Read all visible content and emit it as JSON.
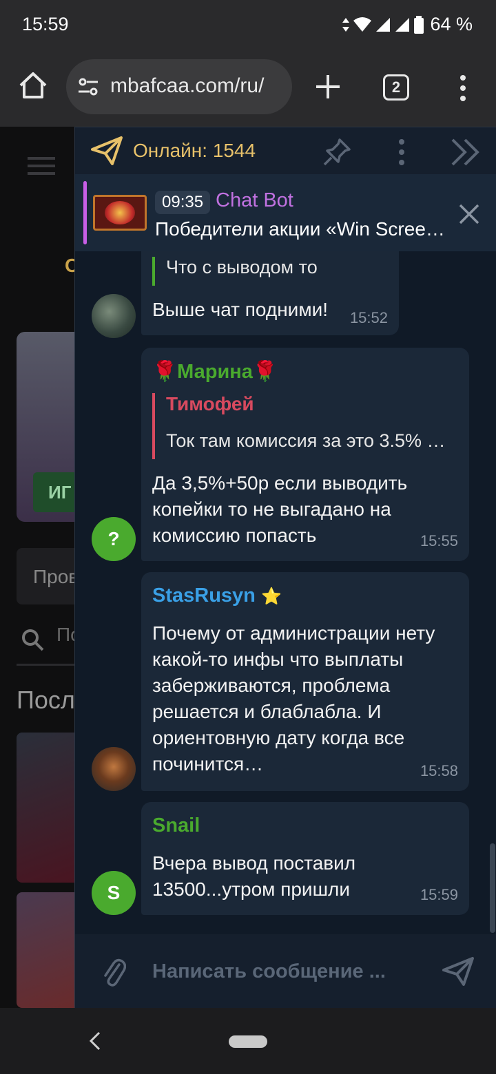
{
  "status_bar": {
    "time": "15:59",
    "battery": "64 %"
  },
  "browser": {
    "url": "mbafcaa.com/ru/",
    "tab_count": "2"
  },
  "site": {
    "promo_button": "ИГ",
    "letter": "С",
    "input_text": "Пров",
    "search_text": "По",
    "heading": "Посл"
  },
  "chat": {
    "online_label": "Онлайн: 1544",
    "pinned": {
      "time": "09:35",
      "author": "Chat Bot",
      "text": "Победители акции «Win Screen…"
    },
    "messages": [
      {
        "id": "m1",
        "quote_text": "Что с выводом то",
        "text": "Выше чат подними!",
        "time": "15:52"
      },
      {
        "id": "m2",
        "author": "🌹Марина🌹",
        "author_color": "#4aaa2e",
        "quote_author": "Тимофей",
        "quote_color": "#d84a5f",
        "quote_text": "Ток там комиссия за это 3.5% …",
        "text_lines": [
          "Да 3,5%+50р если выводить",
          "копейки то не выгадано на",
          "комиссию попасть"
        ],
        "time": "15:55",
        "avatar_letter": "?"
      },
      {
        "id": "m3",
        "author": "StasRusyn",
        "author_color": "#3aa0e6",
        "badge": "⭐",
        "text_lines": [
          "Почему от администрации нету",
          "какой-то инфы что выплаты",
          "заберживаются, проблема",
          "решается и блаблабла. И",
          "ориентовную дату когда все",
          "починится…"
        ],
        "time": "15:58"
      },
      {
        "id": "m4",
        "author": "Snail",
        "author_color": "#4aaa2e",
        "text_lines": [
          "Вчера вывод поставил",
          "13500...утром пришли"
        ],
        "time": "15:59",
        "avatar_letter": "S"
      }
    ],
    "composer_placeholder": "Написать сообщение ..."
  },
  "icons": {
    "home": "home-icon",
    "tune": "site-settings-icon",
    "plus": "new-tab-icon",
    "menu": "more-vert-icon",
    "plane": "telegram-plane-icon",
    "pin": "pin-icon",
    "dots": "more-vert-icon",
    "collapse": "double-chevron-right-icon",
    "close": "close-icon",
    "clip": "paperclip-icon",
    "send": "send-icon"
  }
}
